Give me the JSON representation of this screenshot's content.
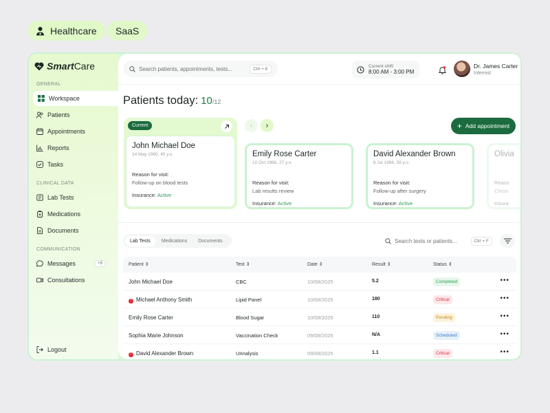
{
  "tags": [
    "Healthcare",
    "SaaS"
  ],
  "logo": {
    "bold": "Smart",
    "rest": "Care"
  },
  "sidebar": {
    "sections": [
      "GENERAL",
      "CLINICAL DATA",
      "COMMUNICATION"
    ],
    "general": [
      {
        "label": "Workspace",
        "icon": "grid-icon",
        "active": true
      },
      {
        "label": "Patients",
        "icon": "users-icon"
      },
      {
        "label": "Appointments",
        "icon": "calendar-icon"
      },
      {
        "label": "Reports",
        "icon": "chart-icon"
      },
      {
        "label": "Tasks",
        "icon": "check-icon"
      }
    ],
    "clinical": [
      {
        "label": "Lab Tests",
        "icon": "flask-icon"
      },
      {
        "label": "Medications",
        "icon": "pill-icon"
      },
      {
        "label": "Documents",
        "icon": "document-icon"
      }
    ],
    "communication": [
      {
        "label": "Messages",
        "icon": "chat-icon",
        "badge": "+8"
      },
      {
        "label": "Consultations",
        "icon": "video-icon"
      }
    ],
    "logout": "Logout"
  },
  "header": {
    "search_placeholder": "Search patients, appointments, tests...",
    "search_shortcut": "Ctrl + K",
    "shift_label": "Current shift:",
    "shift_value": "8:00 AM - 3:00 PM",
    "user_name": "Dr. James Carter",
    "user_role": "Internist"
  },
  "patients_today": {
    "title": "Patients today:",
    "count": "10",
    "total": "/12"
  },
  "add_appointment": "Add appointment",
  "current_label": "Current",
  "cards": [
    {
      "name": "John Michael Doe",
      "dob": "14 May 1980, 45 y.o.",
      "reason_label": "Reason for visit:",
      "reason": "Follow-up on blood tests",
      "insurance_label": "Insurance:",
      "insurance": "Active"
    },
    {
      "name": "Emily Rose Carter",
      "dob": "10 Oct 1966, 27 y.o.",
      "reason_label": "Reason for visit:",
      "reason": "Lab results review",
      "insurance_label": "Insurance:",
      "insurance": "Active"
    },
    {
      "name": "David Alexander Brown",
      "dob": "6 Jul 1966, 58 y.o.",
      "reason_label": "Reason for visit:",
      "reason": "Follow-up after surgery",
      "insurance_label": "Insurance:",
      "insurance": "Active"
    },
    {
      "name": "Olivia",
      "dob": "",
      "reason_label": "Reaso",
      "reason": "Chron",
      "insurance_label": "Insura",
      "insurance": ""
    }
  ],
  "table_tabs": [
    "Lab Tests",
    "Medications",
    "Documents"
  ],
  "table_search": {
    "placeholder": "Search tests or patients...",
    "shortcut": "Ctrl + F"
  },
  "columns": [
    "Patient",
    "Test",
    "Date",
    "Result",
    "Status"
  ],
  "rows": [
    {
      "patient": "John Michael Doe",
      "alert": false,
      "test": "CBC",
      "date": "10/08/2025",
      "result": "5.2",
      "status": "Completed"
    },
    {
      "patient": "Michael Anthony Smith",
      "alert": true,
      "test": "Lipid Panel",
      "date": "10/08/2025",
      "result": "180",
      "status": "Critical"
    },
    {
      "patient": "Emily Rose Carter",
      "alert": false,
      "test": "Blood Sugar",
      "date": "10/08/2025",
      "result": "110",
      "status": "Pending"
    },
    {
      "patient": "Sophia Marie Johnson",
      "alert": false,
      "test": "Vaccination Check",
      "date": "09/08/2025",
      "result": "N/A",
      "status": "Scheduled"
    },
    {
      "patient": "David Alexander Brown",
      "alert": true,
      "test": "Urinalysis",
      "date": "09/08/2025",
      "result": "1.1",
      "status": "Critical"
    }
  ],
  "status_colors": {
    "Completed": {
      "bg": "#e7f8ea",
      "fg": "#2e9b57"
    },
    "Critical": {
      "bg": "#fde8ea",
      "fg": "#d6333d"
    },
    "Pending": {
      "bg": "#fdf3dc",
      "fg": "#c08a13"
    },
    "Scheduled": {
      "bg": "#e6f1fb",
      "fg": "#3b7fc4"
    }
  },
  "colors": {
    "accent": "#1b6b3f",
    "lime": "#e1f9c9",
    "active_green": "#2e9b57"
  }
}
